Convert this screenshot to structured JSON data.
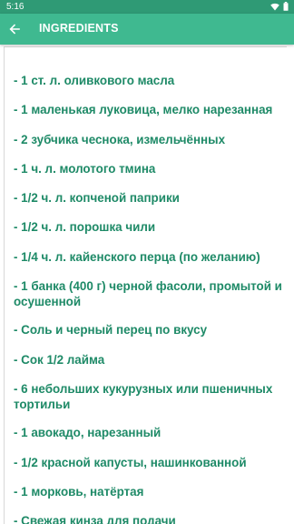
{
  "status_bar": {
    "time": "5:16",
    "icons": [
      "wifi-icon",
      "battery-icon"
    ]
  },
  "app_bar": {
    "title": "INGREDIENTS",
    "back_icon": "arrow-left-icon"
  },
  "colors": {
    "status_bar": "#2f9a75",
    "app_bar": "#3fb990",
    "item_text": "#1e8a67"
  },
  "ingredients": [
    " - 1 ст. л. оливкового масла",
    " - 1 маленькая луковица, мелко нарезанная",
    " - 2 зубчика чеснока, измельчённых",
    " - 1 ч. л. молотого тмина",
    " - 1/2 ч. л. копченой паприки",
    " - 1/2 ч. л. порошка чили",
    " - 1/4 ч. л. кайенского перца (по желанию)",
    " - 1 банка (400 г) черной фасоли, промытой и осушенной",
    " - Соль и черный перец по вкусу",
    " - Сок 1/2 лайма",
    " - 6 небольших кукурузных или пшеничных тортильи",
    " - 1 авокадо, нарезанный",
    " - 1/2 красной капусты, нашинкованной",
    " - 1 морковь, натёртая",
    " - Свежая кинза для подачи"
  ]
}
